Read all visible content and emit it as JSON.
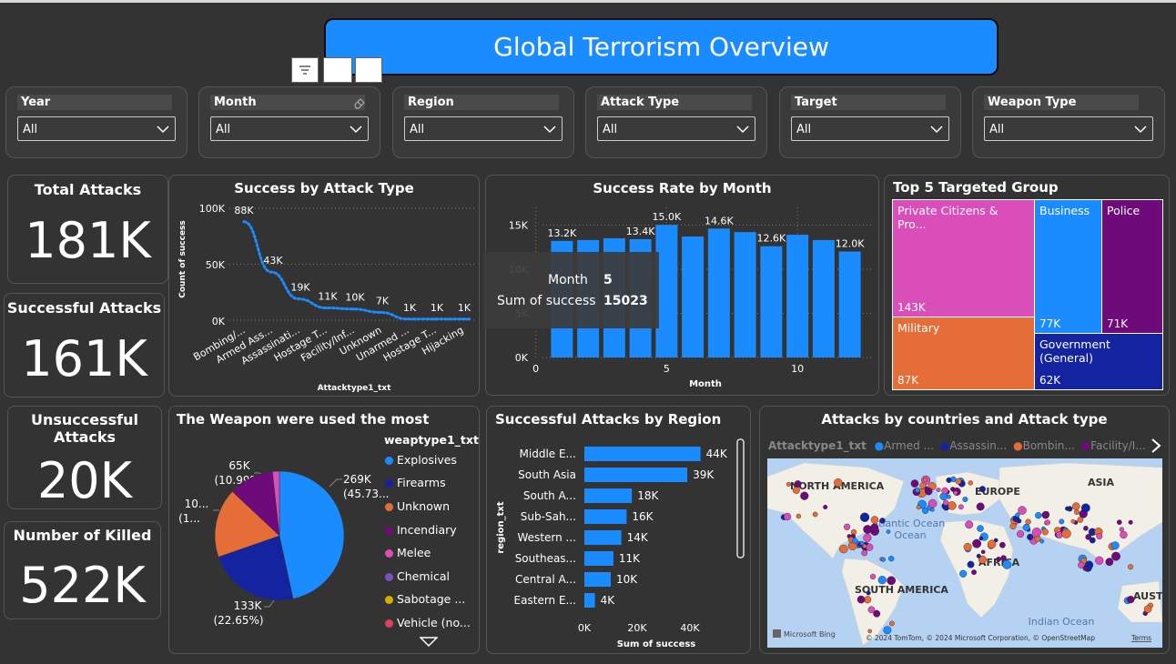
{
  "header": {
    "title": "Global Terrorism Overview"
  },
  "slicers": [
    {
      "label": "Year",
      "value": "All"
    },
    {
      "label": "Month",
      "value": "All"
    },
    {
      "label": "Region",
      "value": "All"
    },
    {
      "label": "Attack Type",
      "value": "All"
    },
    {
      "label": "Target",
      "value": "All"
    },
    {
      "label": "Weapon Type",
      "value": "All"
    }
  ],
  "kpis": {
    "total": {
      "title": "Total Attacks",
      "value": "181K"
    },
    "successful": {
      "title": "Successful Attacks",
      "value": "161K"
    },
    "unsuccessful": {
      "title": "Unsuccessful Attacks",
      "value": "20K"
    },
    "killed": {
      "title": "Number of Killed",
      "value": "522K"
    }
  },
  "attack_type_chart": {
    "title": "Success by Attack Type",
    "ylabel": "Count of success",
    "xlabel": "Attacktype1_txt",
    "y_ticks": [
      "100K",
      "50K",
      "0K"
    ]
  },
  "month_chart": {
    "title": "Success Rate by Month",
    "xlabel": "Month",
    "ylabel": "Sum of success",
    "y_ticks": [
      "15K",
      "10K",
      "5K",
      "0K"
    ],
    "x_ticks": [
      "0",
      "5",
      "10"
    ],
    "tooltip": {
      "k1": "Month",
      "v1": "5",
      "k2": "Sum of success",
      "v2": "15023"
    }
  },
  "treemap": {
    "title": "Top 5 Targeted Group",
    "items": [
      {
        "label": "Private Citizens & Pro...",
        "value": "143K",
        "color": "#d94eb8"
      },
      {
        "label": "Business",
        "value": "77K",
        "color": "#1a8cff"
      },
      {
        "label": "Police",
        "value": "71K",
        "color": "#6f0a7a"
      },
      {
        "label": "Military",
        "value": "87K",
        "color": "#e56d38"
      },
      {
        "label": "Government (General)",
        "value": "62K",
        "color": "#1424a0"
      }
    ]
  },
  "weapon_chart": {
    "title": "The Weapon were used the most",
    "legend_title": "weaptype1_txt",
    "legend": [
      {
        "label": "Explosives",
        "color": "#1a8cff"
      },
      {
        "label": "Firearms",
        "color": "#1424a0"
      },
      {
        "label": "Unknown",
        "color": "#e56d38"
      },
      {
        "label": "Incendiary",
        "color": "#6f0a7a"
      },
      {
        "label": "Melee",
        "color": "#d94eb8"
      },
      {
        "label": "Chemical",
        "color": "#7b4fc4"
      },
      {
        "label": "Sabotage ...",
        "color": "#d4b000"
      },
      {
        "label": "Vehicle (no...",
        "color": "#e0405a"
      }
    ],
    "labels": {
      "exp_val": "269K",
      "exp_pct": "(45.73...",
      "fir_val": "133K",
      "fir_pct": "(22.65%)",
      "unk_val": "10...",
      "unk_pct": "(1...",
      "inc_val": "65K",
      "inc_pct": "(10.99%)"
    }
  },
  "region_chart": {
    "title": "Successful Attacks by Region",
    "ylabel": "region_txt",
    "xlabel": "Sum of success",
    "x_ticks": [
      "0K",
      "20K",
      "40K"
    ]
  },
  "map_chart": {
    "title": "Attacks by countries and Attack type",
    "legend_title": "Attacktype1_txt",
    "legend": [
      {
        "label": "Armed ...",
        "color": "#1a8cff"
      },
      {
        "label": "Assassin...",
        "color": "#1424a0"
      },
      {
        "label": "Bombin...",
        "color": "#e56d38"
      },
      {
        "label": "Facility/I...",
        "color": "#6f0a7a"
      }
    ],
    "labels": {
      "na": "NORTH AMERICA",
      "eu": "EUROPE",
      "as": "ASIA",
      "ao": "Atlantic Ocean",
      "af": "AFRICA",
      "sa": "SOUTH AMERICA",
      "au": "AUSTRAL",
      "io": "Indian Ocean"
    },
    "brand": "Microsoft Bing",
    "copyright": "© 2024 TomTom, © 2024 Microsoft Corporation, © OpenStreetMap",
    "terms": "Terms"
  },
  "chart_data": [
    {
      "type": "line",
      "title": "Success by Attack Type",
      "xlabel": "Attacktype1_txt",
      "ylabel": "Count of success",
      "categories": [
        "Bombing/...",
        "Armed Ass...",
        "Assassinati...",
        "Hostage T...",
        "Facility/Inf...",
        "Unknown",
        "Unarmed ...",
        "Hostage T...",
        "Hijacking"
      ],
      "values": [
        88000,
        43000,
        19000,
        11000,
        10000,
        7000,
        1000,
        1000,
        1000
      ],
      "data_labels": [
        "88K",
        "43K",
        "19K",
        "11K",
        "10K",
        "7K",
        "1K",
        "1K",
        "1K"
      ],
      "ylim": [
        0,
        100000
      ]
    },
    {
      "type": "bar",
      "title": "Success Rate by Month",
      "xlabel": "Month",
      "ylabel": "Sum of success",
      "categories": [
        1,
        2,
        3,
        4,
        5,
        6,
        7,
        8,
        9,
        10,
        11,
        12
      ],
      "values": [
        13200,
        13300,
        13500,
        13400,
        15023,
        13700,
        14600,
        14200,
        12600,
        13900,
        13300,
        12000
      ],
      "data_labels": {
        "1": "13.2K",
        "4": "13.4K",
        "5": "15.0K",
        "7": "14.6K",
        "9": "12.6K",
        "12": "12.0K"
      },
      "ylim": [
        0,
        17000
      ]
    },
    {
      "type": "pie",
      "title": "The Weapon were used the most",
      "categories": [
        "Explosives",
        "Firearms",
        "Unknown",
        "Incendiary",
        "Melee"
      ],
      "values": [
        269000,
        133000,
        100000,
        65000,
        10000
      ]
    },
    {
      "type": "bar",
      "title": "Successful Attacks by Region",
      "xlabel": "Sum of success",
      "ylabel": "region_txt",
      "categories": [
        "Middle E...",
        "South Asia",
        "South A...",
        "Sub-Sah...",
        "Western ...",
        "Southeas...",
        "Central A...",
        "Eastern E..."
      ],
      "values": [
        44000,
        39000,
        18000,
        16000,
        14000,
        11000,
        10000,
        4000
      ],
      "data_labels": [
        "44K",
        "39K",
        "18K",
        "16K",
        "14K",
        "11K",
        "10K",
        "4K"
      ],
      "xlim": [
        0,
        45000
      ]
    }
  ]
}
